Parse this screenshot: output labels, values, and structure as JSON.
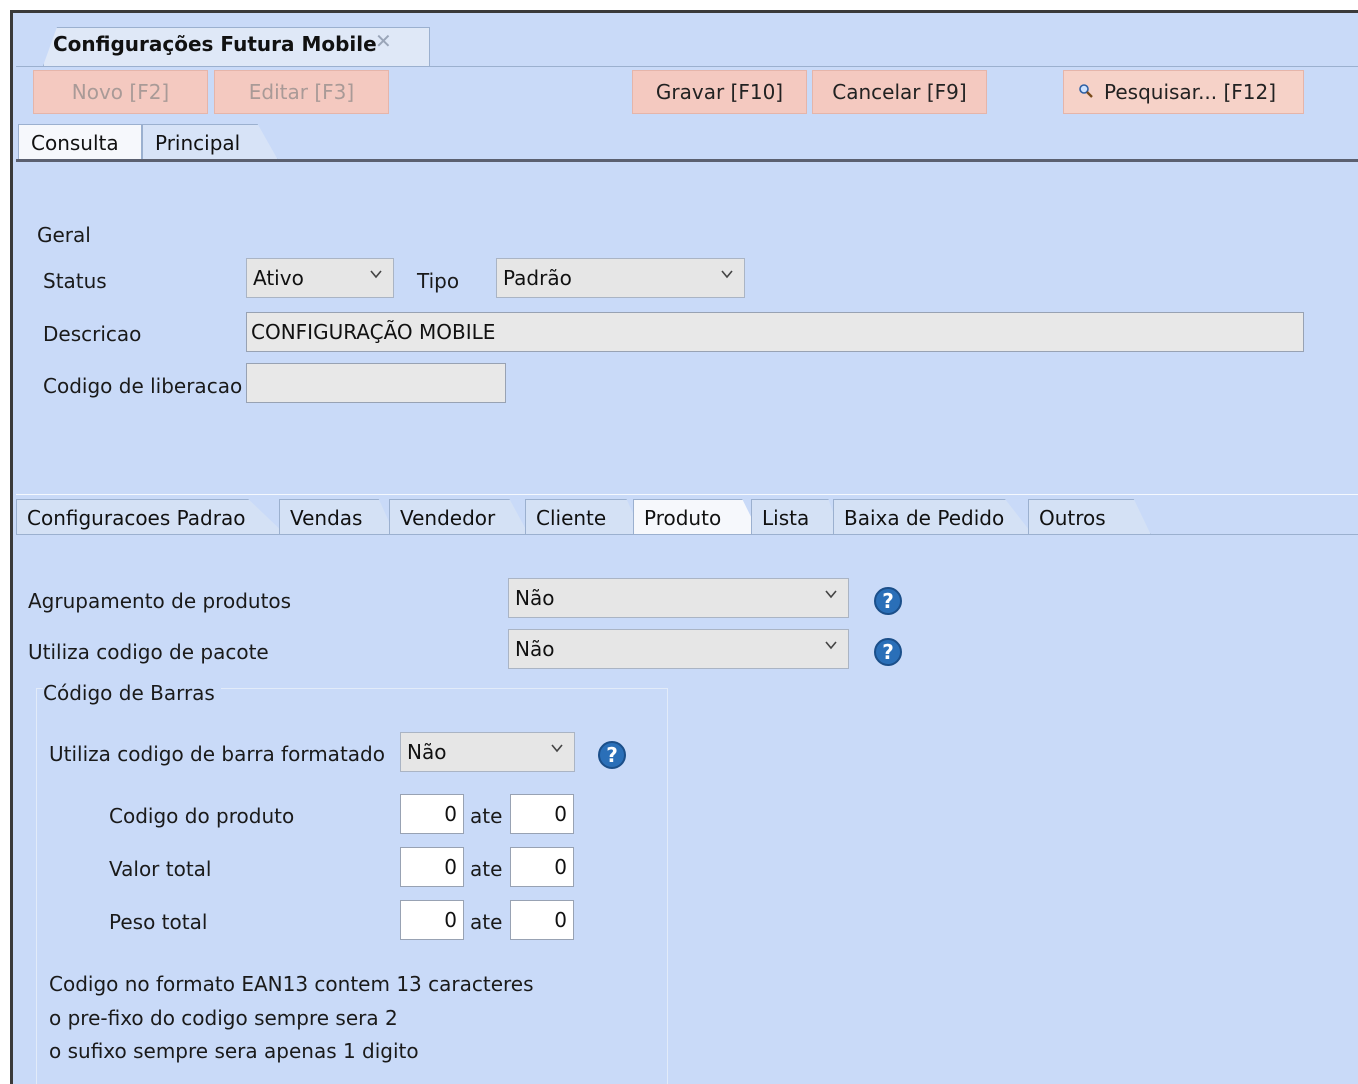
{
  "window": {
    "tab_title": "Configurações Futura Mobile",
    "close_glyph": "✕"
  },
  "toolbar": {
    "novo": "Novo [F2]",
    "editar": "Editar [F3]",
    "gravar": "Gravar [F10]",
    "cancelar": "Cancelar [F9]",
    "pesquisar": "Pesquisar... [F12]",
    "pesquisar_icon": "magnifier-icon"
  },
  "top_tabs": {
    "consulta": "Consulta",
    "principal": "Principal"
  },
  "geral": {
    "section_title": "Geral",
    "status_label": "Status",
    "status_value": "Ativo",
    "tipo_label": "Tipo",
    "tipo_value": "Padrão",
    "descricao_label": "Descricao",
    "descricao_value": "CONFIGURAÇÃO MOBILE",
    "codigo_liberacao_label": "Codigo de liberacao",
    "codigo_liberacao_value": ""
  },
  "sub_tabs": [
    "Configuracoes Padrao",
    "Vendas",
    "Vendedor",
    "Cliente",
    "Produto",
    "Lista",
    "Baixa de Pedido",
    "Outros"
  ],
  "produto": {
    "agrupamento_label": "Agrupamento de produtos",
    "agrupamento_value": "Não",
    "pacote_label": "Utiliza codigo de pacote",
    "pacote_value": "Não",
    "help_glyph": "?",
    "barcode": {
      "group_title": "Código de Barras",
      "formatado_label": "Utiliza codigo de barra formatado",
      "formatado_value": "Não",
      "ate": "ate",
      "rows": [
        {
          "label": "Codigo do produto",
          "from": "0",
          "to": "0"
        },
        {
          "label": "Valor total",
          "from": "0",
          "to": "0"
        },
        {
          "label": "Peso total",
          "from": "0",
          "to": "0"
        }
      ],
      "notes": [
        "Codigo no formato EAN13 contem 13 caracteres",
        "o pre-fixo do codigo sempre sera 2",
        "o sufixo sempre sera apenas 1 digito"
      ]
    }
  }
}
